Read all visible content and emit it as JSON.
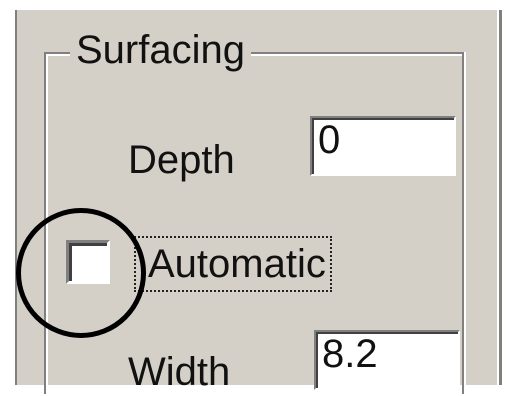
{
  "group": {
    "title": "Surfacing"
  },
  "depth": {
    "label": "Depth",
    "value": "0"
  },
  "automatic": {
    "label": "Automatic",
    "checked": false
  },
  "width": {
    "label": "Width",
    "value": "8.2"
  },
  "annotation": {
    "shape": "circle",
    "color": "#000000"
  }
}
